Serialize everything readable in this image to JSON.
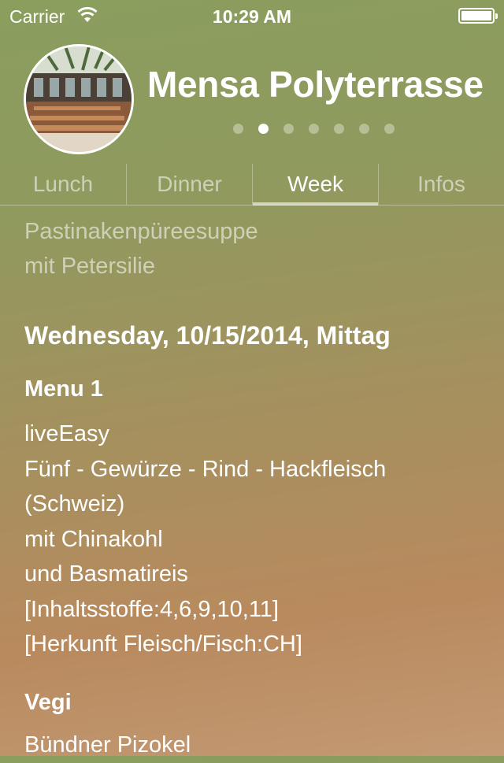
{
  "status_bar": {
    "carrier": "Carrier",
    "time": "10:29 AM"
  },
  "header": {
    "title": "Mensa Polyterrasse",
    "page_count": 7,
    "active_page": 1
  },
  "tabs": [
    {
      "label": "Lunch",
      "active": false
    },
    {
      "label": "Dinner",
      "active": false
    },
    {
      "label": "Week",
      "active": true
    },
    {
      "label": "Infos",
      "active": false
    }
  ],
  "content": {
    "previous_item_lines": [
      "Pastinakenpüreesuppe",
      "mit Petersilie"
    ],
    "day_heading": "Wednesday, 10/15/2014, Mittag",
    "menus": [
      {
        "title": "Menu 1",
        "lines": [
          "liveEasy",
          "Fünf - Gewürze - Rind - Hackfleisch",
          "(Schweiz)",
          "mit Chinakohl",
          "und Basmatireis",
          "[Inhaltsstoffe:4,6,9,10,11]",
          "[Herkunft Fleisch/Fisch:CH]"
        ]
      },
      {
        "title": "Vegi",
        "lines": [
          "Bündner Pizokel"
        ]
      }
    ]
  }
}
